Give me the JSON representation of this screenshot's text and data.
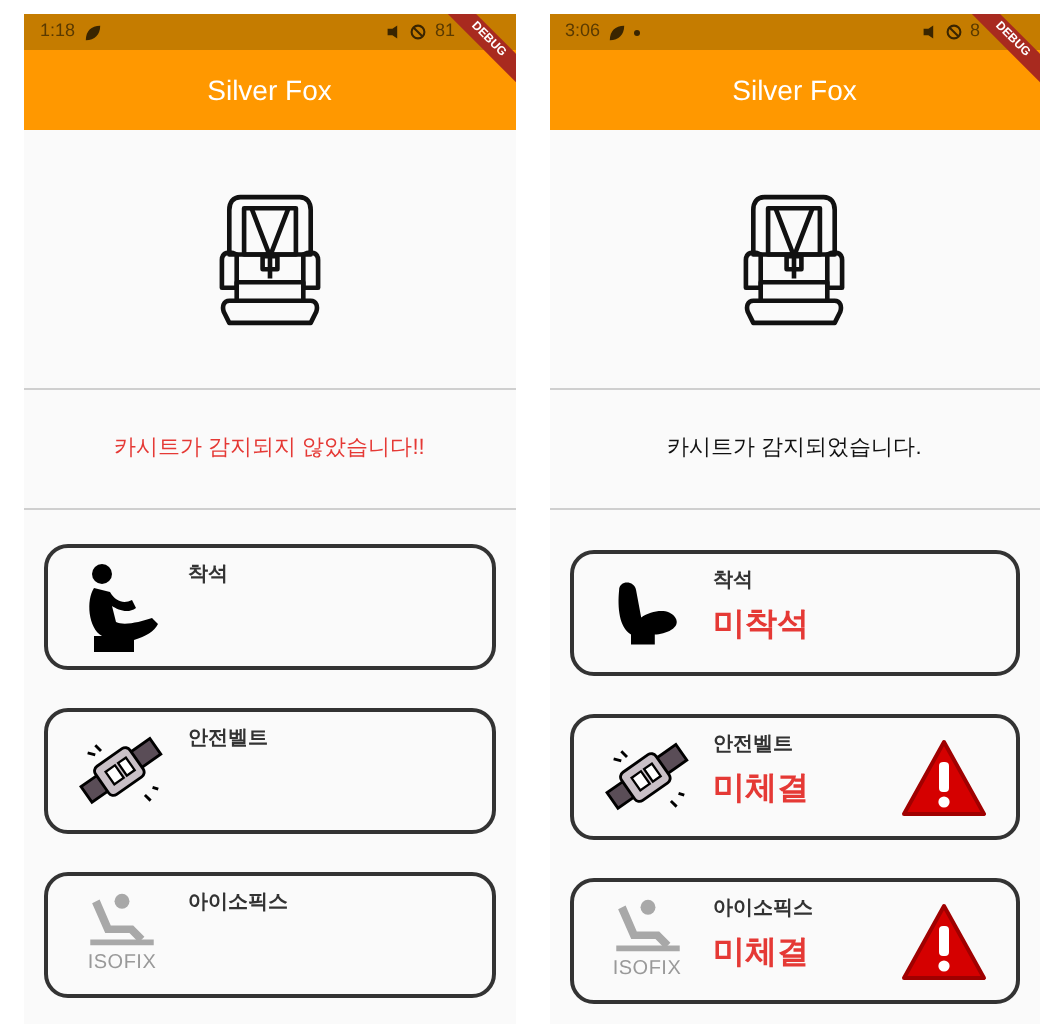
{
  "screens": [
    {
      "status_bar": {
        "time": "1:18",
        "battery": "81"
      },
      "app_bar": {
        "title": "Silver Fox"
      },
      "debug_banner": "DEBUG",
      "seat_detected": false,
      "message": "카시트가 감지되지 않았습니다!!",
      "cards": [
        {
          "kind": "seated",
          "label": "착석",
          "warning": false
        },
        {
          "kind": "belt",
          "label": "안전벨트",
          "warning": false
        },
        {
          "kind": "isofix",
          "label": "아이소픽스",
          "caption": "ISOFIX",
          "warning": false
        }
      ]
    },
    {
      "status_bar": {
        "time": "3:06",
        "battery": "8",
        "notification_dot": true
      },
      "app_bar": {
        "title": "Silver Fox"
      },
      "debug_banner": "DEBUG",
      "seat_detected": true,
      "message": "카시트가 감지되었습니다.",
      "cards": [
        {
          "kind": "empty-seat",
          "label": "착석",
          "status": "미착석",
          "warning": false
        },
        {
          "kind": "belt",
          "label": "안전벨트",
          "status": "미체결",
          "warning": true
        },
        {
          "kind": "isofix",
          "label": "아이소픽스",
          "caption": "ISOFIX",
          "status": "미체결",
          "warning": true
        }
      ]
    }
  ]
}
